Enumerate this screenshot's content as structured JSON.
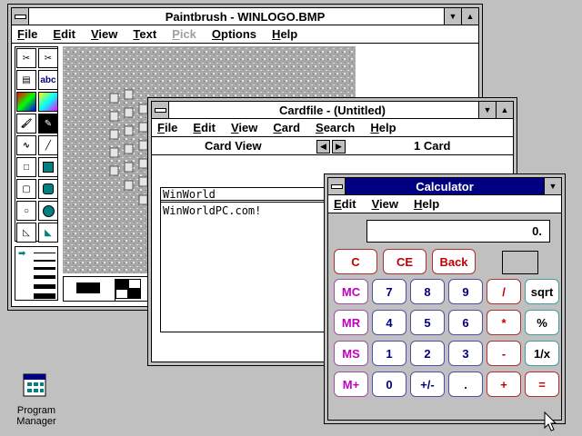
{
  "paintbrush": {
    "title": "Paintbrush - WINLOGO.BMP",
    "menu": [
      "File",
      "Edit",
      "View",
      "Text",
      "Pick",
      "Options",
      "Help"
    ],
    "tool_abc": "abc"
  },
  "cardfile": {
    "title": "Cardfile - (Untitled)",
    "menu": [
      "File",
      "Edit",
      "View",
      "Card",
      "Search",
      "Help"
    ],
    "view_mode": "Card View",
    "card_count": "1 Card",
    "card_index": "WinWorld",
    "card_text": "WinWorldPC.com!"
  },
  "calculator": {
    "title": "Calculator",
    "menu": [
      "Edit",
      "View",
      "Help"
    ],
    "display": "0.",
    "buttons": {
      "c": "C",
      "ce": "CE",
      "back": "Back",
      "mc": "MC",
      "mr": "MR",
      "ms": "MS",
      "mplus": "M+",
      "n7": "7",
      "n8": "8",
      "n9": "9",
      "div": "/",
      "sqrt": "sqrt",
      "n4": "4",
      "n5": "5",
      "n6": "6",
      "mul": "*",
      "pct": "%",
      "n1": "1",
      "n2": "2",
      "n3": "3",
      "sub": "-",
      "inv": "1/x",
      "n0": "0",
      "sign": "+/-",
      "dot": ".",
      "add": "+",
      "eq": "="
    }
  },
  "desktop": {
    "program_manager_line1": "Program",
    "program_manager_line2": "Manager"
  }
}
